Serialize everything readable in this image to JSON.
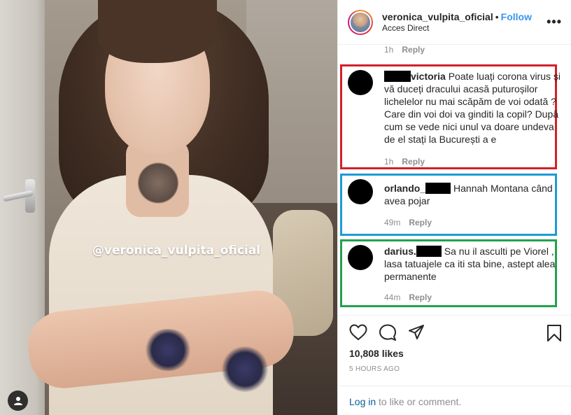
{
  "photo": {
    "watermark": "@veronica_vulpita_oficial",
    "user_tag_icon": "person-icon"
  },
  "header": {
    "username": "veronica_vulpita_oficial",
    "separator": "•",
    "follow_label": "Follow",
    "subtitle": "Acces Direct",
    "more_icon": "more-options-icon"
  },
  "comments": {
    "previous_meta": {
      "time": "1h",
      "reply": "Reply"
    },
    "items": [
      {
        "user_suffix": "victoria",
        "text": "Poate luați corona virus și vă duceți dracului acasă puturoșilor lichelelor nu mai scăpăm de voi odată ? Care din voi doi va ginditi la copil? După cum se vede nici unul va doare undeva de el stați la București a e",
        "time": "1h",
        "reply": "Reply",
        "box_color": "#d32027"
      },
      {
        "user_prefix": "orlando_",
        "text": "Hannah Montana când avea pojar",
        "time": "49m",
        "reply": "Reply",
        "box_color": "#1e9ad6"
      },
      {
        "user_prefix": "darius.",
        "text": "Sa nu il asculti pe Viorel , lasa tatuajele ca iti sta bine, astept alea permanente",
        "time": "44m",
        "reply": "Reply",
        "box_color": "#23a24d"
      }
    ]
  },
  "actions": {
    "icons": [
      "heart-icon",
      "comment-icon",
      "share-icon",
      "bookmark-icon"
    ],
    "likes": "10,808 likes",
    "time": "5 HOURS AGO",
    "login_link": "Log in",
    "login_rest": " to like or comment."
  }
}
